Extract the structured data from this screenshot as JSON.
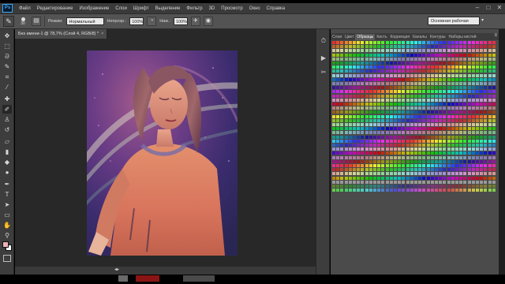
{
  "app": {
    "logo_text": "Ps",
    "menu": [
      "Файл",
      "Редактирование",
      "Изображение",
      "Слои",
      "Шрифт",
      "Выделение",
      "Фильтр",
      "3D",
      "Просмотр",
      "Окно",
      "Справка"
    ],
    "window_controls": [
      "–",
      "□",
      "✕"
    ]
  },
  "options_bar": {
    "brush_size": "30",
    "mode_label": "Режим:",
    "mode_value": "Нормальный",
    "opacity_label": "Непрозр.:",
    "opacity_value": "100%",
    "flow_label": "Наж.:",
    "flow_value": "100%",
    "workspace": "Основная рабочая среда"
  },
  "document": {
    "tab_title": "Без имени-1 @ 78,7% (Слой 4, RGB/8) *",
    "tab_close": "×"
  },
  "panel": {
    "tabs": [
      "Слои",
      "Цвет",
      "Образцы",
      "Кисть",
      "Коррекция",
      "Каналы",
      "Контуры",
      "Наборы кистей"
    ],
    "active_tab": "Образцы",
    "menu_icon": "≡"
  },
  "colors": {
    "foreground": "#f0b0b8",
    "background": "#ffffff"
  },
  "tools": [
    "move-icon",
    "marquee-icon",
    "lasso-icon",
    "quick-select-icon",
    "crop-icon",
    "eyedropper-icon",
    "healing-icon",
    "brush-icon",
    "stamp-icon",
    "history-brush-icon",
    "eraser-icon",
    "gradient-icon",
    "blur-icon",
    "dodge-icon",
    "pen-icon",
    "type-icon",
    "path-select-icon",
    "shape-icon",
    "hand-icon",
    "zoom-icon"
  ],
  "strip_icons": [
    "history-icon",
    "actions-icon",
    "properties-icon"
  ]
}
